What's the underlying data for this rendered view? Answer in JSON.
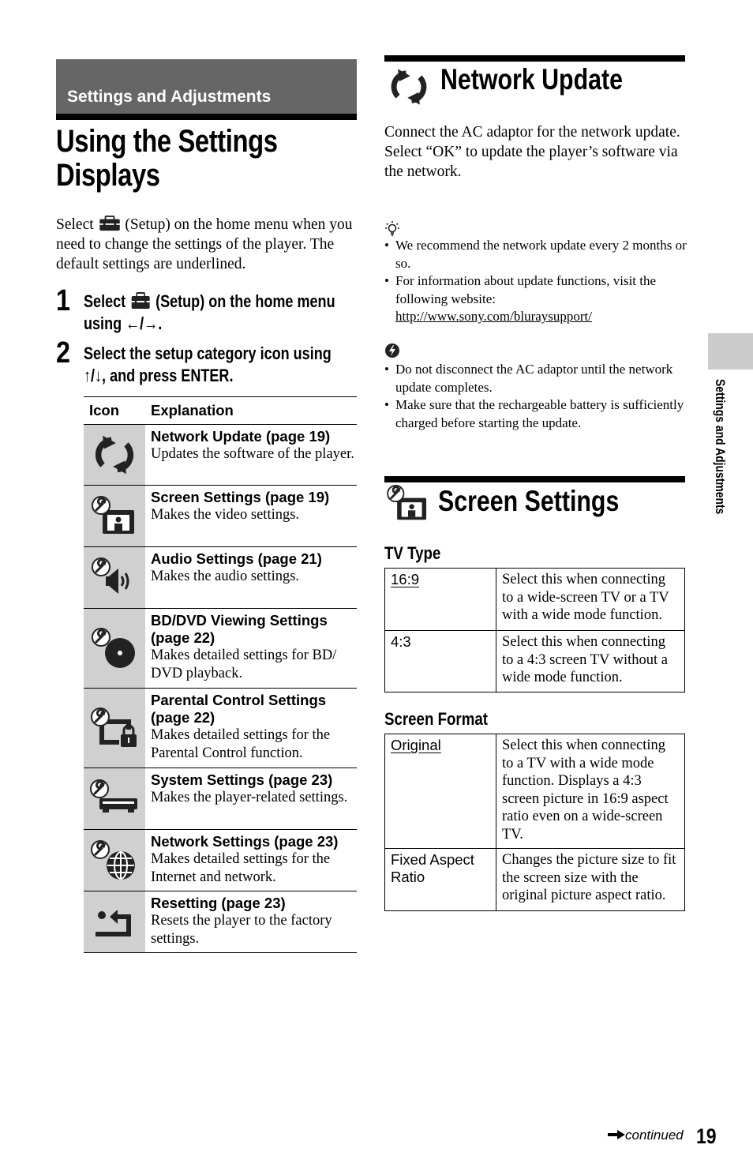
{
  "section_header": "Settings and Adjustments",
  "page_title": [
    "Using the Settings",
    "Displays"
  ],
  "intro": {
    "before_icon": "Select",
    "icon": "setup-toolbox-icon",
    "after_icon": "(Setup) on the home menu when you need to change the settings of the player. The default settings are underlined."
  },
  "steps": [
    {
      "number": "1",
      "line1_before_icon": "Select",
      "icon": "setup-toolbox-icon",
      "line1_after_icon": "(Setup) on the home menu",
      "line2": "using ←/→."
    },
    {
      "number": "2",
      "line1": "Select the setup category icon using",
      "line2": "↑/↓, and press ENTER."
    }
  ],
  "icon_table": {
    "headers": [
      "Icon",
      "Explanation"
    ],
    "rows": [
      {
        "icon": "network-update-icon",
        "title": "Network Update (page 19)",
        "desc": "Updates the software of the player."
      },
      {
        "icon": "screen-settings-icon",
        "title": "Screen Settings (page 19)",
        "desc": "Makes the video settings."
      },
      {
        "icon": "audio-settings-icon",
        "title": "Audio Settings (page 21)",
        "desc": "Makes the audio settings."
      },
      {
        "icon": "bd-dvd-viewing-settings-icon",
        "title": "BD/DVD Viewing Settings (page 22)",
        "desc": "Makes detailed settings for BD/ DVD playback."
      },
      {
        "icon": "parental-control-settings-icon",
        "title": "Parental Control Settings (page 22)",
        "desc": "Makes detailed settings for the Parental Control function."
      },
      {
        "icon": "system-settings-icon",
        "title": "System Settings (page 23)",
        "desc": "Makes the player-related settings."
      },
      {
        "icon": "network-settings-icon",
        "title": "Network Settings (page 23)",
        "desc": "Makes detailed settings for the Internet and network."
      },
      {
        "icon": "resetting-icon",
        "title": "Resetting (page 23)",
        "desc": "Resets the player to the factory settings."
      }
    ]
  },
  "network_update": {
    "heading": "Network Update",
    "icon": "network-update-icon",
    "body": [
      "Connect the AC adaptor for the network update.",
      "Select “OK” to update the player’s software via the network."
    ],
    "hint_icon": "hint-lightbulb-icon",
    "hints": [
      "We recommend the network update every 2 months or so.",
      "For information about update functions, visit the following website:"
    ],
    "hint_link": "http://www.sony.com/bluraysupport/",
    "note_icon": "caution-note-icon",
    "notes": [
      "Do not disconnect the AC adaptor until the network update completes.",
      "Make sure that the rechargeable battery is sufficiently charged before starting the update."
    ]
  },
  "screen_settings": {
    "heading": "Screen Settings",
    "icon": "screen-settings-icon",
    "tv_type": {
      "title": "TV Type",
      "rows": [
        {
          "option": "16:9",
          "default": true,
          "desc": "Select this when connecting to a wide-screen TV or a TV with a wide mode function."
        },
        {
          "option": "4:3",
          "default": false,
          "desc": "Select this when connecting to a 4:3 screen TV without a wide mode function."
        }
      ]
    },
    "screen_format": {
      "title": "Screen Format",
      "rows": [
        {
          "option": "Original",
          "default": true,
          "desc": "Select this when connecting to a TV with a wide mode function. Displays a 4:3 screen picture in 16:9 aspect ratio even on a wide-screen TV."
        },
        {
          "option": "Fixed Aspect Ratio",
          "default": false,
          "desc": "Changes the picture size to fit the screen size with the original picture aspect ratio."
        }
      ]
    }
  },
  "side_tab_label": "Settings and Adjustments",
  "footer": {
    "continued": "continued",
    "page_number": "19"
  }
}
